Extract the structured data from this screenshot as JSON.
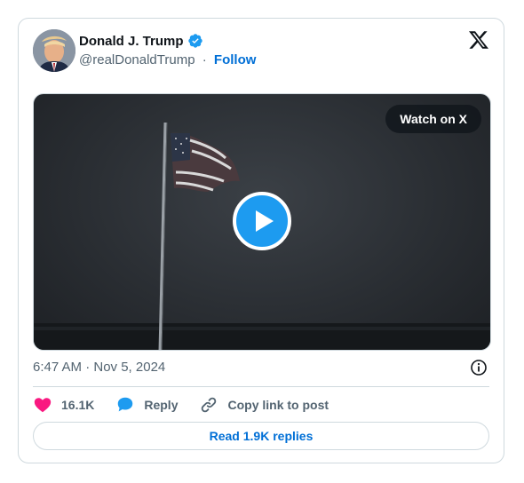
{
  "author": {
    "name": "Donald J. Trump",
    "handle": "@realDonaldTrump",
    "separator": "·",
    "follow_label": "Follow"
  },
  "media": {
    "watch_label": "Watch on X"
  },
  "timestamp": "6:47 AM · Nov 5, 2024",
  "actions": {
    "like_count": "16.1K",
    "reply_label": "Reply",
    "copy_label": "Copy link to post"
  },
  "read_replies_label": "Read 1.9K replies",
  "icons": {
    "avatar": "profile-photo",
    "verified": "verified-badge-icon",
    "x_logo": "x-logo-icon",
    "play": "play-icon",
    "info": "info-icon",
    "heart": "heart-icon",
    "reply": "speech-bubble-icon",
    "link": "link-icon"
  },
  "colors": {
    "accent": "#1d9bf0",
    "link": "#006fd6",
    "heart": "#f91880",
    "text": "#0f1419",
    "muted": "#536471",
    "border": "#cfd9de"
  }
}
